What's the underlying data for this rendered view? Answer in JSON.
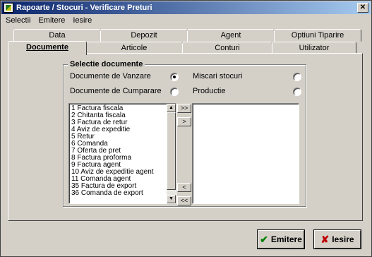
{
  "window": {
    "title": "Rapoarte / Stocuri - Verificare Preturi",
    "close_label": "✕"
  },
  "menu": {
    "items": [
      "Selectii",
      "Emitere",
      "Iesire"
    ]
  },
  "tabs": {
    "back_row": [
      "Data",
      "Depozit",
      "Agent",
      "Optiuni Tiparire"
    ],
    "front_row": [
      "Documente",
      "Articole",
      "Conturi",
      "Utilizator"
    ],
    "active": "Documente"
  },
  "selection": {
    "title": "Selectie documente",
    "options": [
      {
        "label": "Documente de Vanzare",
        "checked": true
      },
      {
        "label": "Miscari stocuri",
        "checked": false
      },
      {
        "label": "Documente de Cumparare",
        "checked": false
      },
      {
        "label": "Productie",
        "checked": false
      }
    ]
  },
  "available_list": [
    "1 Factura fiscala",
    "2 Chitanta fiscala",
    "3 Factura de retur",
    "4 Aviz de expeditie",
    "5 Retur",
    "6 Comanda",
    "7 Oferta de pret",
    "8 Factura proforma",
    "9 Factura agent",
    "10 Aviz de expeditie agent",
    "11 Comanda agent",
    "35 Factura de export",
    "36 Comanda de export"
  ],
  "move_buttons": {
    "add_all": ">>",
    "add": ">",
    "remove": "<",
    "remove_all": "<<"
  },
  "buttons": {
    "emit": {
      "label": "Emitere",
      "icon": "check-icon",
      "color": "#008000"
    },
    "exit": {
      "label": "Iesire",
      "icon": "x-icon",
      "color": "#c00000"
    }
  }
}
